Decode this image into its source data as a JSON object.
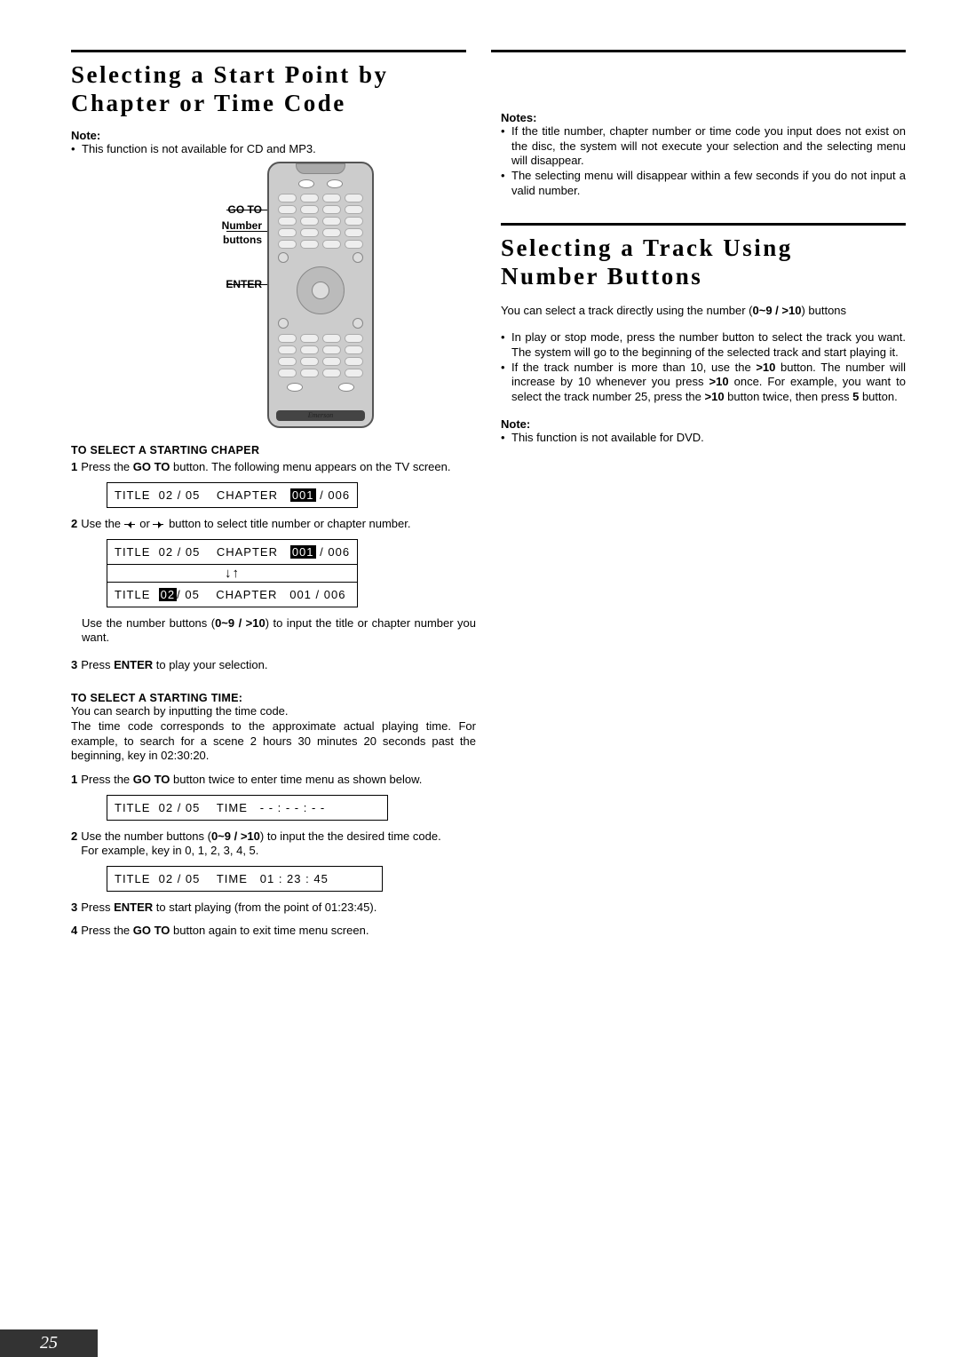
{
  "page_number": "25",
  "left": {
    "h1a": "Selecting a Start Point by",
    "h1b": "Chapter or Time Code",
    "note_label": "Note:",
    "note_item": "This function is not available for CD and MP3.",
    "remote_labels": {
      "goto": "GO TO",
      "number": "Number",
      "buttons": "buttons",
      "enter": "ENTER",
      "brand": "Emerson"
    },
    "subhead_chapter": "TO SELECT A STARTING CHAPER",
    "step1_num": "1",
    "step1_a": "Press the ",
    "step1_b": "GO TO",
    "step1_c": " button. The following menu appears on the TV screen.",
    "osd1": {
      "title_word": "TITLE",
      "title_val": "02 / 05",
      "chapter_word": "CHAPTER",
      "chap_hl": "001",
      "chap_rest": " / 006"
    },
    "step2_num": "2",
    "step2_a": "Use the ",
    "step2_or": " or ",
    "step2_b": " button to select title number or chapter number.",
    "osd2_top": {
      "title_word": "TITLE",
      "title_val": "02 / 05",
      "chapter_word": "CHAPTER",
      "chap_hl": "001",
      "chap_rest": " / 006"
    },
    "osd2_arrows": "↓↑",
    "osd2_bot": {
      "title_word": "TITLE",
      "title_hl": "02",
      "title_rest": "/ 05",
      "chapter_word": "CHAPTER",
      "chap_val": "001 / 006"
    },
    "step2_note_a": "Use the number buttons (",
    "step2_note_b": "0~9 / >10",
    "step2_note_c": ") to input the title or chapter number you want.",
    "step3_num": "3",
    "step3_a": "Press ",
    "step3_b": "ENTER",
    "step3_c": " to play your selection.",
    "subhead_time": "TO SELECT A STARTING TIME:",
    "time_p1": "You can search by inputting the time code.",
    "time_p2": "The time code corresponds to the approximate actual playing time. For example, to search for a scene 2 hours 30 minutes 20 seconds past the beginning, key in 02:30:20.",
    "t_step1_num": "1",
    "t_step1_a": "Press the ",
    "t_step1_b": "GO TO",
    "t_step1_c": " button twice to enter time menu as shown below.",
    "osd_time1": {
      "title_word": "TITLE",
      "title_val": "02 / 05",
      "time_word": "TIME",
      "time_val": "- - : - - : - -"
    },
    "t_step2_num": "2",
    "t_step2_a": "Use the number buttons (",
    "t_step2_b": "0~9 / >10",
    "t_step2_c": ") to input the the desired time code.",
    "t_step2_ex": "For example, key in 0, 1, 2, 3, 4, 5.",
    "osd_time2": {
      "title_word": "TITLE",
      "title_val": "02 / 05",
      "time_word": "TIME",
      "time_val": "01 : 23 : 45"
    },
    "t_step3_num": "3",
    "t_step3_a": "Press ",
    "t_step3_b": "ENTER",
    "t_step3_c": " to start playing (from the point of 01:23:45).",
    "t_step4_num": "4",
    "t_step4_a": "Press the ",
    "t_step4_b": "GO TO",
    "t_step4_c": " button again to exit time menu screen."
  },
  "right": {
    "notes_label": "Notes:",
    "notes_1": "If the title number, chapter number or time code you input does not exist on the disc, the system will not execute your selection and the selecting menu will disappear.",
    "notes_2": "The selecting menu will disappear within a few seconds if you do not input a valid number.",
    "h2a": "Selecting a Track Using",
    "h2b": "Number Buttons",
    "intro_a": "You can select a track directly using the number (",
    "intro_b": "0~9 / >10",
    "intro_c": ") buttons",
    "bul1": "In play or stop mode, press the number button to select the track you want. The system will go to the beginning of the selected track and start playing it.",
    "bul2_a": "If the track number is more than 10, use the  ",
    "bul2_b": ">10",
    "bul2_c": " button. The number will increase by 10 whenever you press  ",
    "bul2_d": ">10",
    "bul2_e": " once. For example, you want to select the track number 25, press the ",
    "bul2_f": ">10",
    "bul2_g": " button twice, then press ",
    "bul2_h": "5",
    "bul2_i": " button.",
    "note_label": "Note:",
    "note_item": "This function is not available for DVD."
  }
}
